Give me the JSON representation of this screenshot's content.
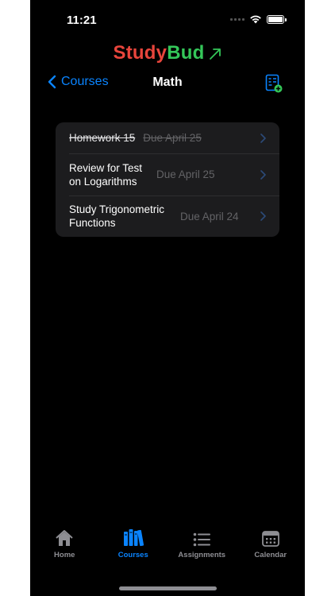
{
  "status_bar": {
    "time": "11:21"
  },
  "app": {
    "title_part1": "Study",
    "title_part2": "Bud"
  },
  "nav": {
    "back_label": "Courses",
    "title": "Math"
  },
  "assignments": [
    {
      "name": "Homework 15",
      "due": "Due April 25",
      "completed": true
    },
    {
      "name": "Review for Test on Logarithms",
      "due": "Due April 25",
      "completed": false
    },
    {
      "name": "Study Trigonometric Functions",
      "due": "Due April 24",
      "completed": false
    }
  ],
  "tabs": [
    {
      "label": "Home",
      "icon": "house-icon",
      "active": false
    },
    {
      "label": "Courses",
      "icon": "books-icon",
      "active": true
    },
    {
      "label": "Assignments",
      "icon": "list-icon",
      "active": false
    },
    {
      "label": "Calendar",
      "icon": "calendar-icon",
      "active": false
    }
  ],
  "colors": {
    "accent": "#0a84ff",
    "brand_red": "#e8453c",
    "brand_green": "#34c759",
    "background": "#000000",
    "card": "#1c1c1e"
  }
}
